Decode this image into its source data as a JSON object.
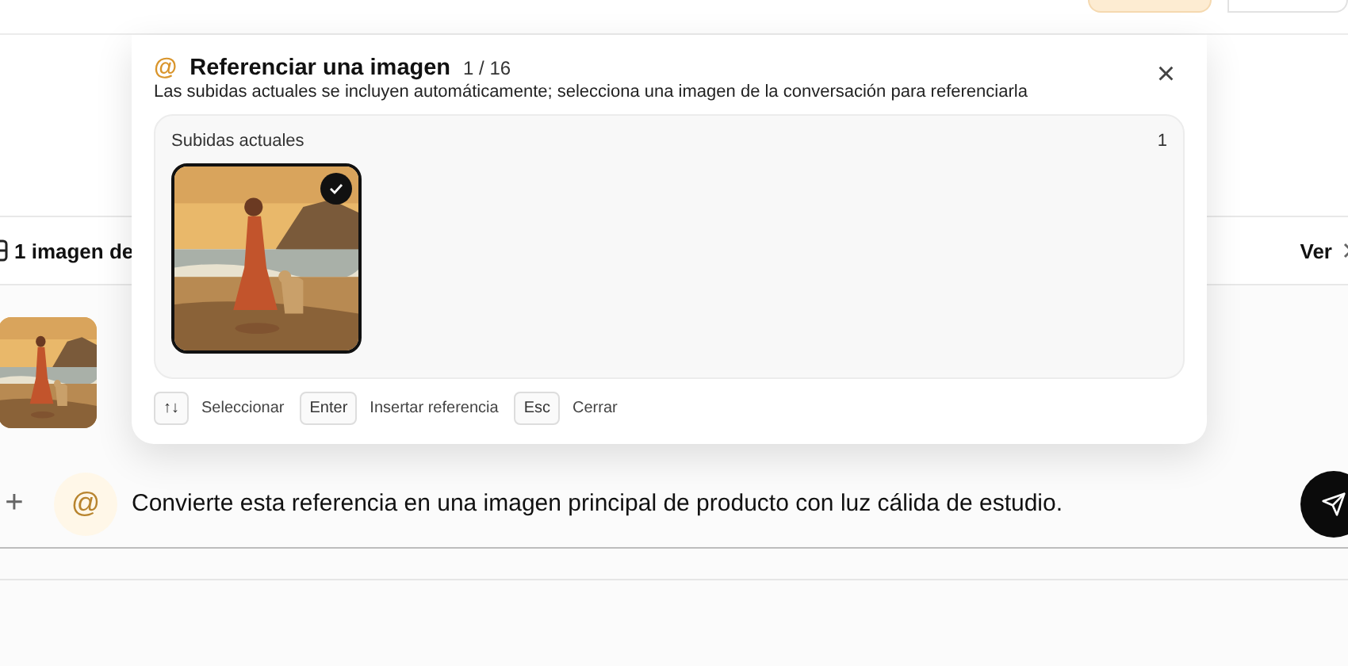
{
  "composer": {
    "plus": "+",
    "mention": "@",
    "value": "Convierte esta referencia en una imagen principal de producto con luz cálida de estudio."
  },
  "attachments_bar": {
    "label": "1 imagen de",
    "action": "Ver"
  },
  "attachments": [
    {
      "kind": "picture"
    }
  ],
  "popup": {
    "icon": "@",
    "title": "Referenciar una imagen",
    "counter": "1 / 16",
    "description": "Las subidas actuales se incluyen automáticamente; selecciona una imagen de la conversación para referenciarla",
    "close": "×",
    "section": {
      "title": "Subidas actuales",
      "count": "1",
      "images": [
        {
          "kind": "picture",
          "selected": true
        }
      ]
    },
    "shortcuts": [
      {
        "key": "↑↓",
        "label": "Seleccionar"
      },
      {
        "key": "Enter",
        "label": "Insertar referencia"
      },
      {
        "key": "Esc",
        "label": "Cerrar"
      }
    ]
  }
}
